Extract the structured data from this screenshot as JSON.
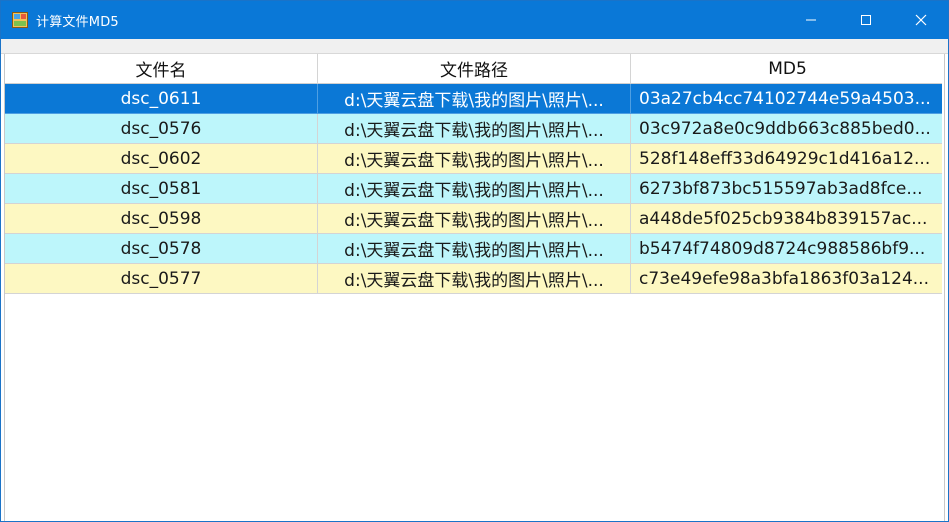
{
  "window": {
    "title": "计算文件MD5"
  },
  "grid": {
    "columns": [
      "文件名",
      "文件路径",
      "MD5"
    ],
    "rows": [
      {
        "name": "dsc_0611",
        "path": "d:\\天翼云盘下载\\我的图片\\照片\\...",
        "md5": "03a27cb4cc74102744e59a4503...",
        "style": "selected"
      },
      {
        "name": "dsc_0576",
        "path": "d:\\天翼云盘下载\\我的图片\\照片\\...",
        "md5": "03c972a8e0c9ddb663c885bed0...",
        "style": "cyan"
      },
      {
        "name": "dsc_0602",
        "path": "d:\\天翼云盘下载\\我的图片\\照片\\...",
        "md5": "528f148eff33d64929c1d416a12...",
        "style": "yellow"
      },
      {
        "name": "dsc_0581",
        "path": "d:\\天翼云盘下载\\我的图片\\照片\\...",
        "md5": "6273bf873bc515597ab3ad8fce...",
        "style": "cyan"
      },
      {
        "name": "dsc_0598",
        "path": "d:\\天翼云盘下载\\我的图片\\照片\\...",
        "md5": "a448de5f025cb9384b839157ac...",
        "style": "yellow"
      },
      {
        "name": "dsc_0578",
        "path": "d:\\天翼云盘下载\\我的图片\\照片\\...",
        "md5": "b5474f74809d8724c988586bf9...",
        "style": "cyan"
      },
      {
        "name": "dsc_0577",
        "path": "d:\\天翼云盘下载\\我的图片\\照片\\...",
        "md5": "c73e49efe98a3bfa1863f03a124...",
        "style": "yellow"
      }
    ]
  },
  "colors": {
    "titlebar": "#0a78d7",
    "selected_row": "#0b78d6",
    "cyan_row": "#bdf6fb",
    "yellow_row": "#fdf8c2"
  },
  "icons": {
    "app": "app-icon",
    "minimize": "minimize-icon",
    "maximize": "maximize-icon",
    "close": "close-icon"
  }
}
